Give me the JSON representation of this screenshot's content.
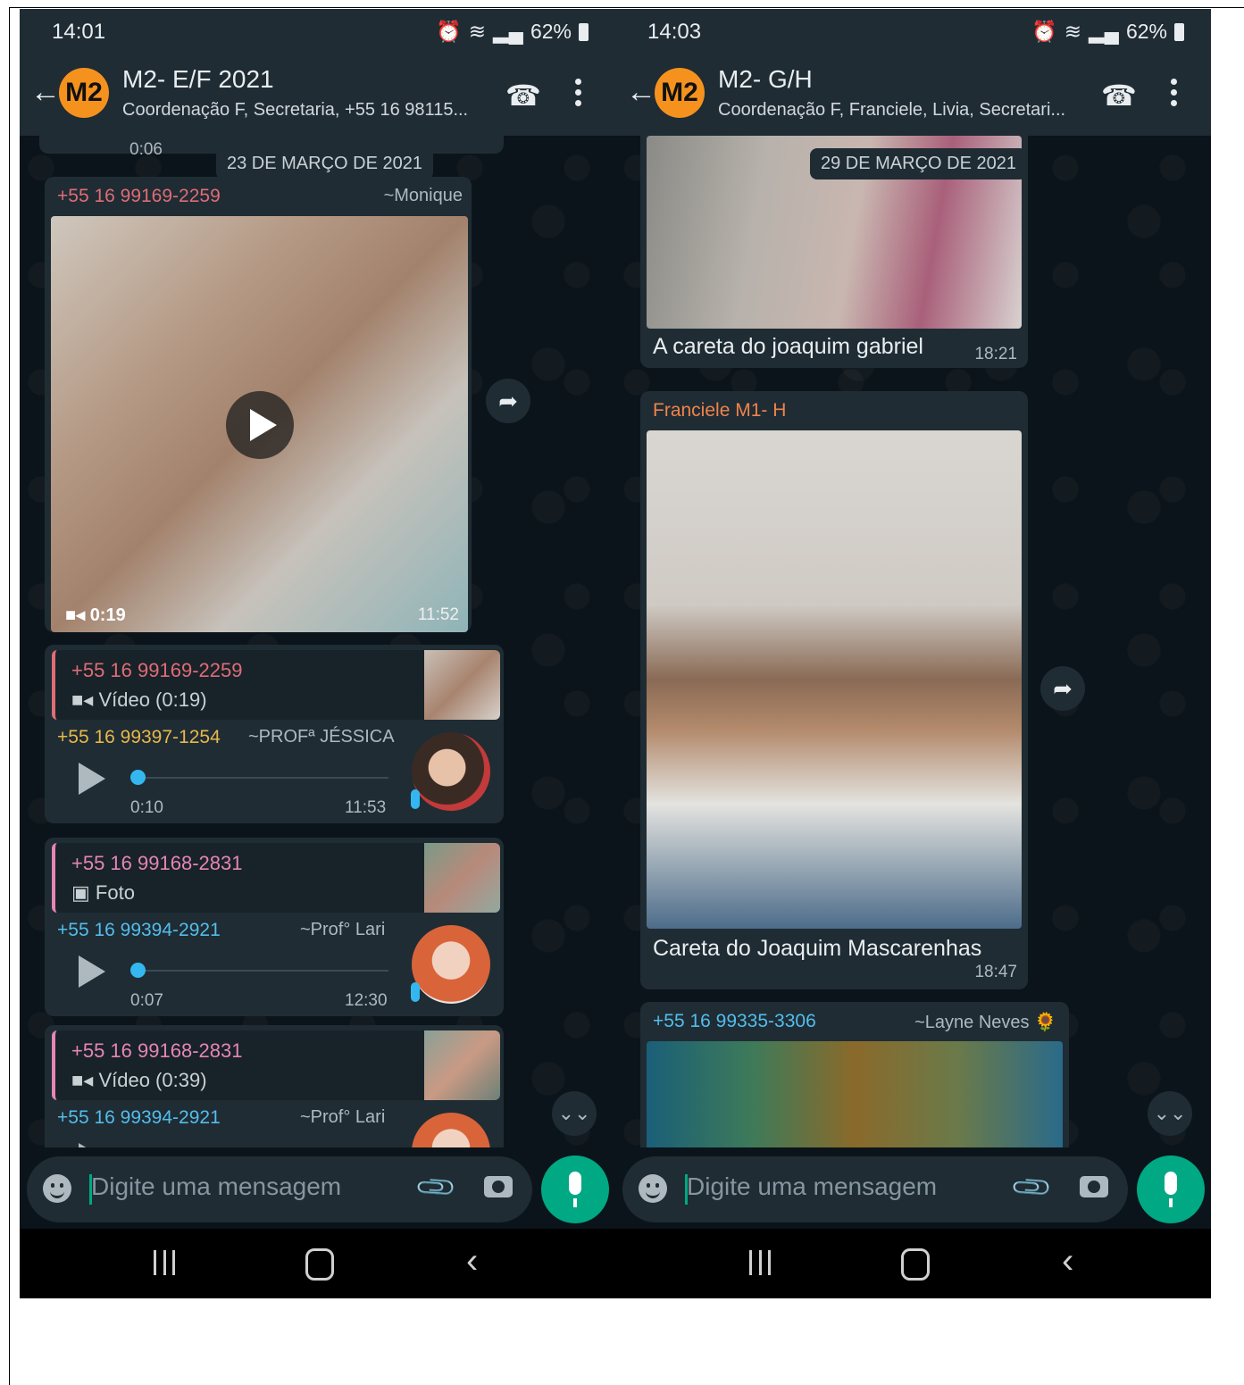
{
  "left": {
    "status": {
      "time": "14:01",
      "battery": "62%"
    },
    "header": {
      "avatar": "M2",
      "title": "M2- E/F 2021",
      "subtitle": "Coordenação F, Secretaria, +55 16 98115..."
    },
    "chat": {
      "top_duration": "0:06",
      "date_chip": "23 DE MARÇO DE 2021",
      "video_msg": {
        "sender": "+55 16 99169-2259",
        "alias": "~Monique",
        "duration": "0:19",
        "time": "11:52"
      },
      "reply1": {
        "quote_name": "+55 16 99169-2259",
        "quote_kind": "Vídeo (0:19)",
        "sender": "+55 16 99397-1254",
        "alias": "~PROFª JÉSSICA",
        "audio_duration": "0:10",
        "time": "11:53"
      },
      "reply2": {
        "quote_name": "+55 16 99168-2831",
        "quote_kind": "Foto",
        "sender": "+55 16 99394-2921",
        "alias": "~Prof° Lari",
        "audio_duration": "0:07",
        "time": "12:30"
      },
      "reply3": {
        "quote_name": "+55 16 99168-2831",
        "quote_kind": "Vídeo (0:39)",
        "sender": "+55 16 99394-2921",
        "alias": "~Prof° Lari"
      }
    },
    "input": {
      "placeholder": "Digite uma mensagem"
    }
  },
  "right": {
    "status": {
      "time": "14:03",
      "battery": "62%"
    },
    "header": {
      "avatar": "M2",
      "title": "M2- G/H",
      "subtitle": "Coordenação F, Franciele, Livia, Secretari..."
    },
    "chat": {
      "date_chip": "29 DE MARÇO DE 2021",
      "msg1": {
        "caption": "A careta do joaquim gabriel",
        "time": "18:21"
      },
      "msg2": {
        "sender": "Franciele M1- H",
        "caption": "Careta do Joaquim Mascarenhas",
        "time": "18:47"
      },
      "msg3": {
        "sender": "+55 16 99335-3306",
        "alias": "~Layne Neves 🌻"
      }
    },
    "input": {
      "placeholder": "Digite uma mensagem"
    }
  },
  "colors": {
    "chat_bg": "#0b141a",
    "bubble": "#1f2c34",
    "accent_green": "#00a884",
    "sender_red": "#e06c75",
    "sender_yellow": "#e8b84a",
    "sender_blue": "#53bdeb",
    "sender_orange": "#f0834a",
    "sender_pink": "#e586b4"
  }
}
